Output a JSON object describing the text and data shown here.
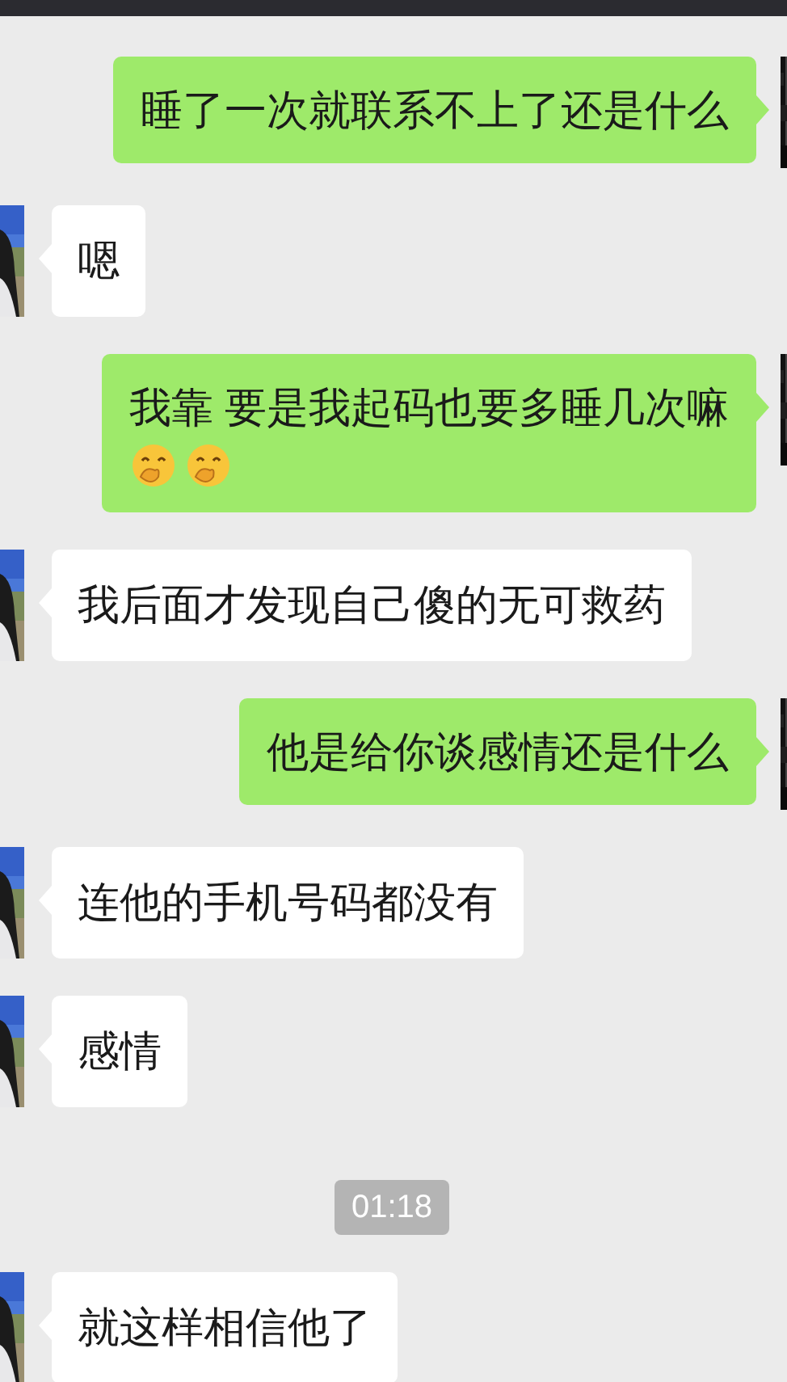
{
  "messages": [
    {
      "kind": "outgoing",
      "text": "睡了一次就联系不上了还是什么"
    },
    {
      "kind": "incoming",
      "text": "嗯"
    },
    {
      "kind": "outgoing",
      "text": "我靠 要是我起码也要多睡几次嘛",
      "icons": [
        {
          "kind": "emoji"
        },
        {
          "kind": "emoji"
        }
      ]
    },
    {
      "kind": "incoming",
      "text": "我后面才发现自己傻的无可救药"
    },
    {
      "kind": "outgoing",
      "text": "他是给你谈感情还是什么"
    },
    {
      "kind": "incoming",
      "text": "连他的手机号码都没有"
    },
    {
      "kind": "incoming",
      "text": "感情"
    },
    {
      "kind": "time",
      "text": "01:18"
    },
    {
      "kind": "incoming",
      "text": "就这样相信他了"
    }
  ]
}
